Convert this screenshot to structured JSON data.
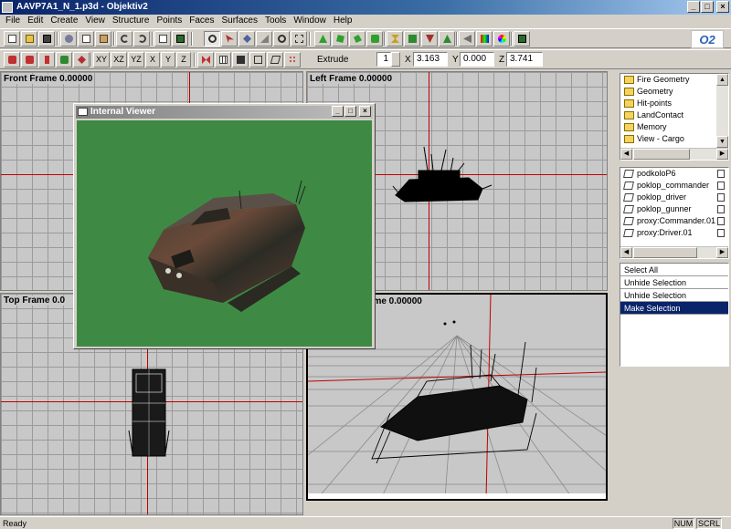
{
  "window": {
    "title": "AAVP7A1_N_1.p3d - Objektiv2"
  },
  "menu": [
    "File",
    "Edit",
    "Create",
    "View",
    "Structure",
    "Points",
    "Faces",
    "Surfaces",
    "Tools",
    "Window",
    "Help"
  ],
  "toolbar2": {
    "axis_buttons": [
      "XY",
      "XZ",
      "YZ",
      "X",
      "Y",
      "Z"
    ],
    "extrude_label": "Extrude",
    "extrude_value": "1",
    "x_label": "X",
    "x_value": "3.163",
    "y_label": "Y",
    "y_value": "0.000",
    "z_label": "Z",
    "z_value": "3.741"
  },
  "logo_text": "O2",
  "viewports": {
    "front": "Front Frame 0.00000",
    "left": "Left Frame 0.00000",
    "top": "Top Frame 0.0",
    "perspective": "rame 0.00000"
  },
  "internal_viewer": {
    "title": "Internal Viewer"
  },
  "lod_list": [
    "Fire Geometry",
    "Geometry",
    "Hit-points",
    "LandContact",
    "Memory",
    "View - Cargo"
  ],
  "selection_list": [
    "podkoloP6",
    "poklop_commander",
    "poklop_driver",
    "poklop_gunner",
    "proxy:Commander.01",
    "proxy:Driver.01"
  ],
  "context_menu": [
    "Select All",
    "Unhide Selection",
    "Unhide Selection",
    "Make Selection"
  ],
  "status": {
    "text": "Ready",
    "num": "NUM",
    "scrl": "SCRL"
  },
  "colors": {
    "title_bar": "#0a246a",
    "viewer_bg": "#3e8a44",
    "axis": "#c00000",
    "selected_row": "#0a246a"
  }
}
